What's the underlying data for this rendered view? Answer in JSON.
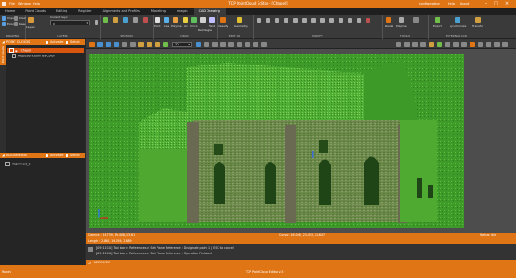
{
  "window": {
    "title": "TCP PointCloud Editor - [Chapel]",
    "menu_left": [
      "File",
      "Window",
      "Help"
    ],
    "user_label": "Configuration",
    "help_label": "Help",
    "about_label": "About"
  },
  "menu_tabs": [
    "Home",
    "Point Clouds",
    "Editing",
    "Register",
    "Alignments and Profiles",
    "Modeling",
    "Images",
    "CAD Drawing"
  ],
  "active_tab": "CAD Drawing",
  "ribbon": {
    "drawing": {
      "label": "DRAWING",
      "import": "Import",
      "export": "Export",
      "clear": "Clear",
      "keep": "Keep",
      "layers": "Layers"
    },
    "layers": {
      "label": "LAYERS",
      "current_layer_label": "Current layer",
      "current_layer_value": "0"
    },
    "section": {
      "label": "SECTION"
    },
    "draw": {
      "label": "DRAW",
      "items": [
        "Point",
        "Line",
        "Polyline",
        "Arc",
        "Circle",
        "Rectangle",
        "Text"
      ]
    },
    "edit": {
      "label": "EDIT CO",
      "items": [
        "Classify",
        "Geometry"
      ]
    },
    "modify": {
      "label": "MODIFY"
    },
    "tools": {
      "label": "TOOLS",
      "items": [
        "Radial",
        "Polyline"
      ]
    },
    "external": {
      "label": "EXTERNAL CAD",
      "items": [
        "Export",
        "Synchronize",
        "Transfer"
      ]
    }
  },
  "left_panel": {
    "point_clouds": {
      "title": "POINT CLOUDS",
      "activate_label": "Activate",
      "select_label": "Select",
      "side_tab": "Point clouds",
      "items": [
        {
          "label": "Chapel",
          "selected": true
        },
        {
          "label": "Representation By Color",
          "selected": false
        }
      ]
    },
    "alignments": {
      "title": "ALIGNMENTS",
      "activate_label": "Activate",
      "select_label": "Select",
      "items": [
        {
          "label": "Alignment_1"
        }
      ]
    }
  },
  "toolbar": {
    "view_select_value": "3D"
  },
  "status": {
    "camera_label": "Camera : 16.739, 19.408, 13.61",
    "length_label": "Length : 2.890, 19.059, 2.689",
    "cursor_label": "Cursor: 16.058, 23.453, 11.647",
    "mode_label": "Status: Idle"
  },
  "log": {
    "lines": [
      "[09:11:10] Tool bar > References > Set Plane Reference : Designate point 1 | ESC to cancel",
      "[09:11:10] Tool bar > References > Set Plane Reference : Operation Finished"
    ],
    "footer_label": "MESSAGES"
  },
  "bottom_bar": {
    "left": "Ready",
    "center": "TCP PointCloud Editor v.5"
  },
  "colors": {
    "accent": "#e07516",
    "selection": "#d9560f",
    "viewport_bg": "#4d4d4d",
    "ground": "#3f9a2c"
  }
}
